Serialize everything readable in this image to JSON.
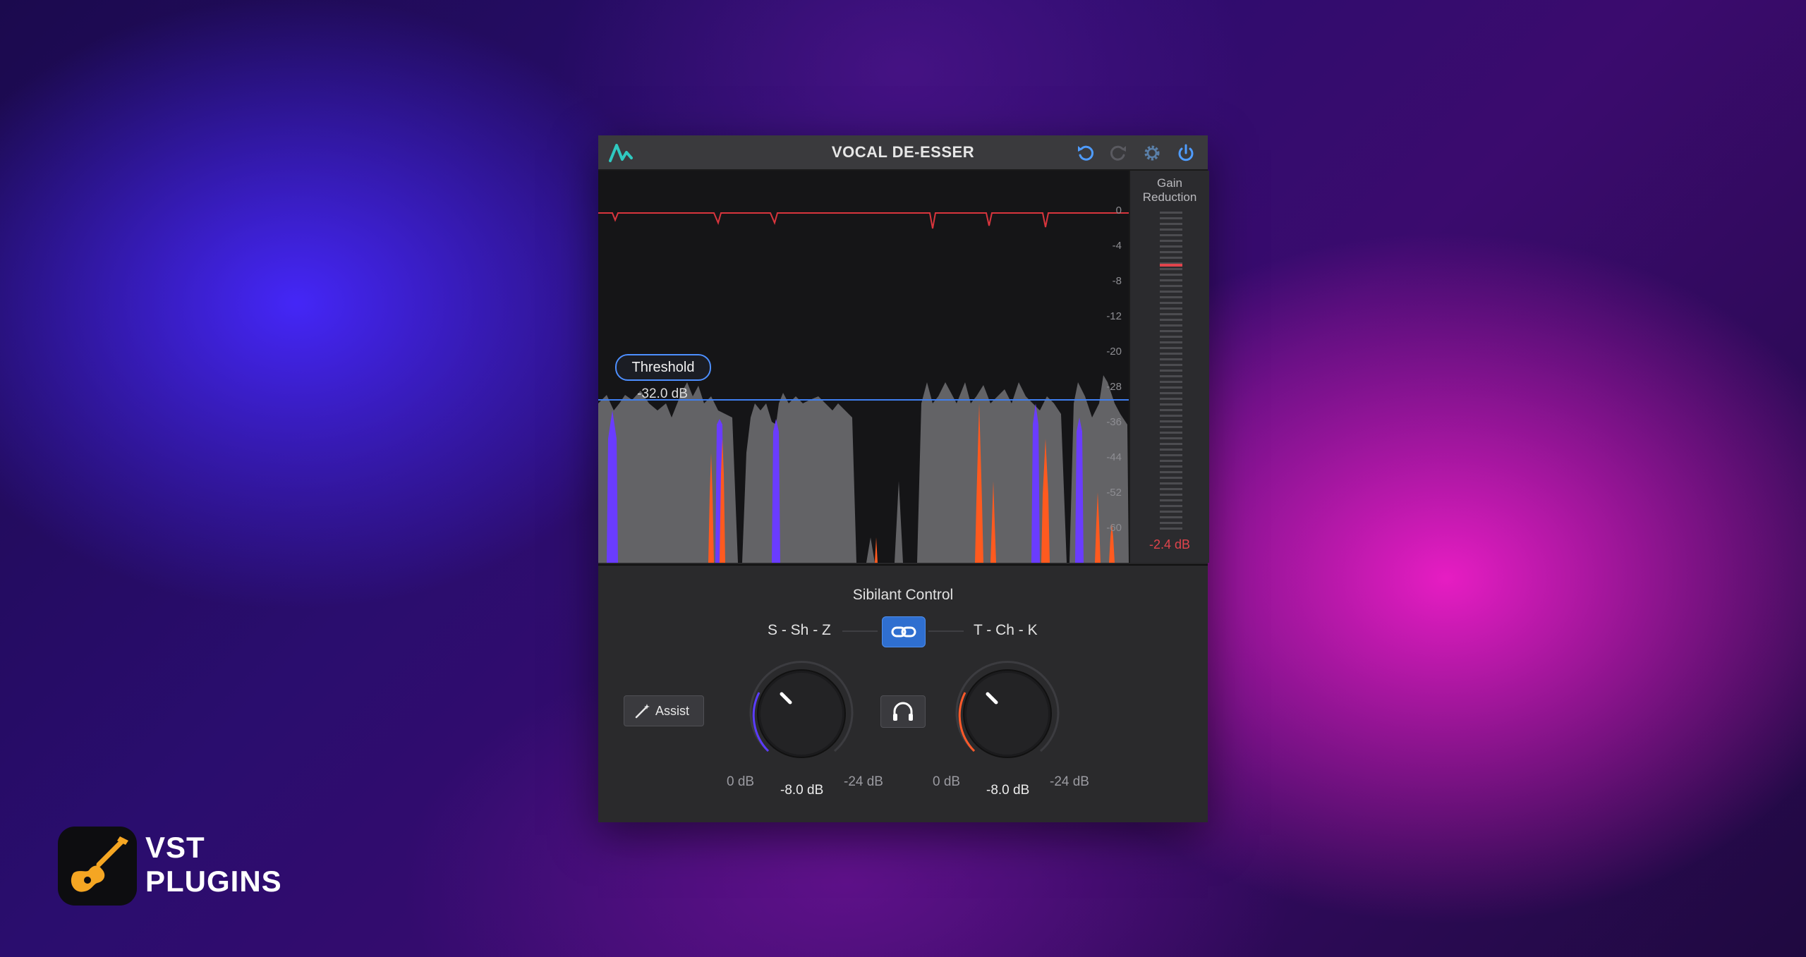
{
  "window": {
    "title": "VOCAL DE-ESSER",
    "icons": [
      "logo-wave-icon",
      "undo-icon",
      "redo-icon",
      "gear-icon",
      "power-icon"
    ]
  },
  "analyzer": {
    "scale": [
      "0",
      "-4",
      "-8",
      "-12",
      "-20",
      "-28",
      "-36",
      "-44",
      "-52",
      "-60"
    ],
    "threshold": {
      "label": "Threshold",
      "value": "-32.0 dB"
    },
    "colors": {
      "threshold": "#3f7ff0",
      "curve": "#d8353d",
      "spectrum": "#6b6b6f",
      "sibilant_low": "#6a3cff",
      "sibilant_high": "#ff5a1f"
    }
  },
  "gain_reduction": {
    "title_line1": "Gain",
    "title_line2": "Reduction",
    "value": "-2.4 dB",
    "level_db": -2.4
  },
  "controls": {
    "title": "Sibilant Control",
    "band_left": "S - Sh - Z",
    "band_right": "T - Ch - K",
    "assist_label": "Assist",
    "knob_left": {
      "min": "0 dB",
      "max": "-24 dB",
      "value": "-8.0 dB",
      "accent": "#5b3cff"
    },
    "knob_right": {
      "min": "0 dB",
      "max": "-24 dB",
      "value": "-8.0 dB",
      "accent": "#ff5a2a"
    }
  },
  "brand": {
    "line1": "VST",
    "line2": "PLUGINS",
    "icon": "guitar-icon"
  }
}
